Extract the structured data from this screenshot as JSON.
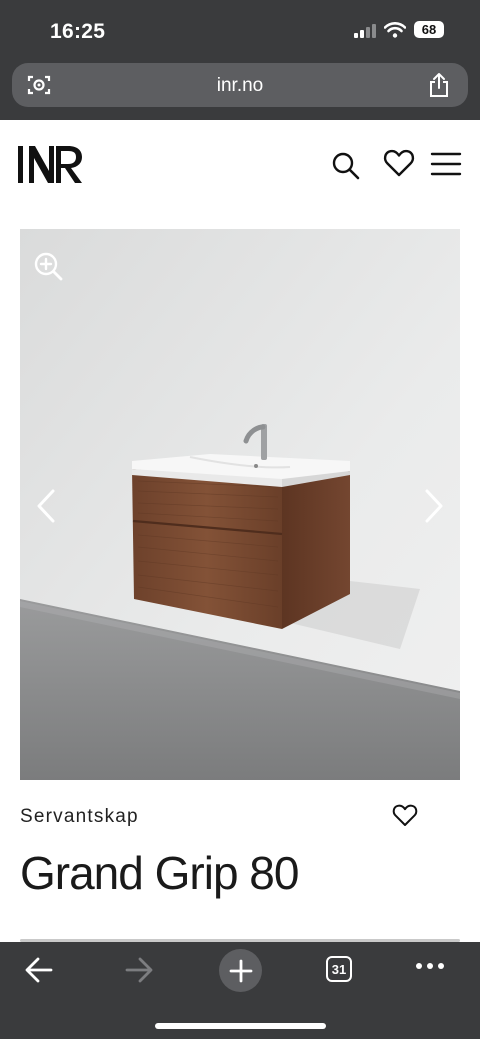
{
  "status_bar": {
    "time": "16:25",
    "battery": "68"
  },
  "browser": {
    "url": "inr.no"
  },
  "site": {
    "logo": "INR"
  },
  "product": {
    "category": "Servantskap",
    "title": "Grand Grip 80"
  },
  "toolbar": {
    "tab_count": "31"
  },
  "icons": [
    "camera-icon",
    "share-icon",
    "search-icon",
    "heart-icon",
    "menu-icon",
    "zoom-in-icon",
    "chevron-left-icon",
    "chevron-right-icon",
    "back-icon",
    "forward-icon",
    "plus-icon",
    "tabs-icon",
    "more-icon"
  ],
  "colors": {
    "browser_chrome": "#3a3b3d",
    "url_field": "#5d5e61",
    "text": "#1a1a1a",
    "wall": "#e6e7e7",
    "floor": "#8a8b8c",
    "cabinet_wood": "#7a4a32",
    "basin": "#f7f7f7"
  }
}
